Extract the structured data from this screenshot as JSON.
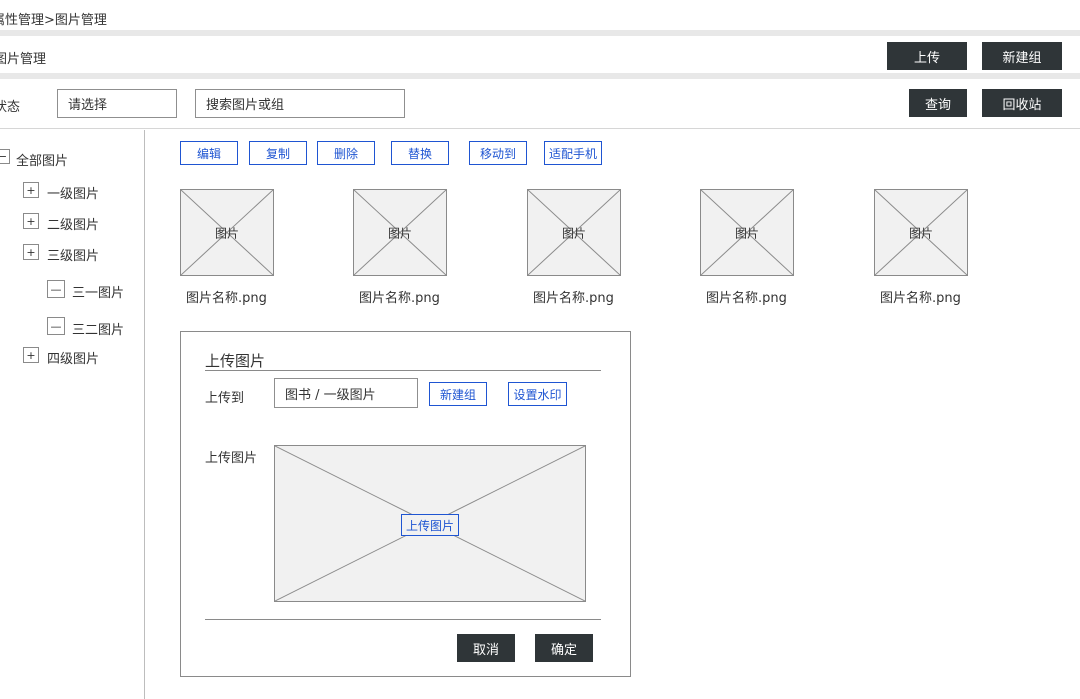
{
  "breadcrumb": "属性管理>图片管理",
  "header": {
    "title": "图片管理",
    "upload_label": "上传",
    "new_group_label": "新建组"
  },
  "filter": {
    "status_label": "状态",
    "status_value": "请选择",
    "search_placeholder": "搜索图片或组",
    "query_label": "查询",
    "recycle_label": "回收站"
  },
  "tree": {
    "root": {
      "toggle": "−",
      "label": "全部图片"
    },
    "items": [
      {
        "toggle": "+",
        "label": "一级图片"
      },
      {
        "toggle": "+",
        "label": "二级图片"
      },
      {
        "toggle": "+",
        "label": "三级图片"
      },
      {
        "toggle": "—",
        "label": "三一图片"
      },
      {
        "toggle": "—",
        "label": "三二图片"
      },
      {
        "toggle": "+",
        "label": "四级图片"
      }
    ]
  },
  "toolbar": {
    "edit": "编辑",
    "copy": "复制",
    "delete": "删除",
    "replace": "替换",
    "move_to": "移动到",
    "fit_mobile": "适配手机"
  },
  "images": [
    {
      "thumb_label": "图片",
      "name": "图片名称.png"
    },
    {
      "thumb_label": "图片",
      "name": "图片名称.png"
    },
    {
      "thumb_label": "图片",
      "name": "图片名称.png"
    },
    {
      "thumb_label": "图片",
      "name": "图片名称.png"
    },
    {
      "thumb_label": "图片",
      "name": "图片名称.png"
    }
  ],
  "upload_dialog": {
    "title": "上传图片",
    "upload_to_label": "上传到",
    "upload_to_value": "图书 / 一级图片",
    "new_group": "新建组",
    "set_watermark": "设置水印",
    "upload_image_label": "上传图片",
    "drop_button": "上传图片",
    "cancel": "取消",
    "confirm": "确定"
  }
}
